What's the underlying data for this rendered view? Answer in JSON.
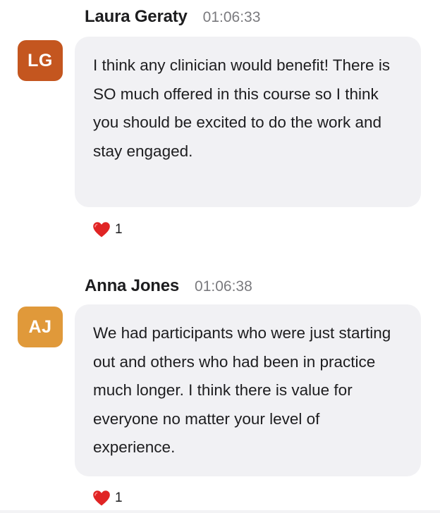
{
  "messages": [
    {
      "author": "Laura Geraty",
      "time": "01:06:33",
      "initials": "LG",
      "avatar_color": "#c4561f",
      "text": "I think any clinician would benefit! There is SO much offered in this course so I think you should be excited to do the work and stay engaged.",
      "reaction": {
        "icon": "heart-icon",
        "count": "1"
      }
    },
    {
      "author": "Anna Jones",
      "time": "01:06:38",
      "initials": "AJ",
      "avatar_color": "#e0993a",
      "text": "We had participants who were just starting out and others who had been in practice much longer. I think there is value for everyone no matter your level of experience.",
      "reaction": {
        "icon": "heart-icon",
        "count": "1"
      }
    }
  ]
}
